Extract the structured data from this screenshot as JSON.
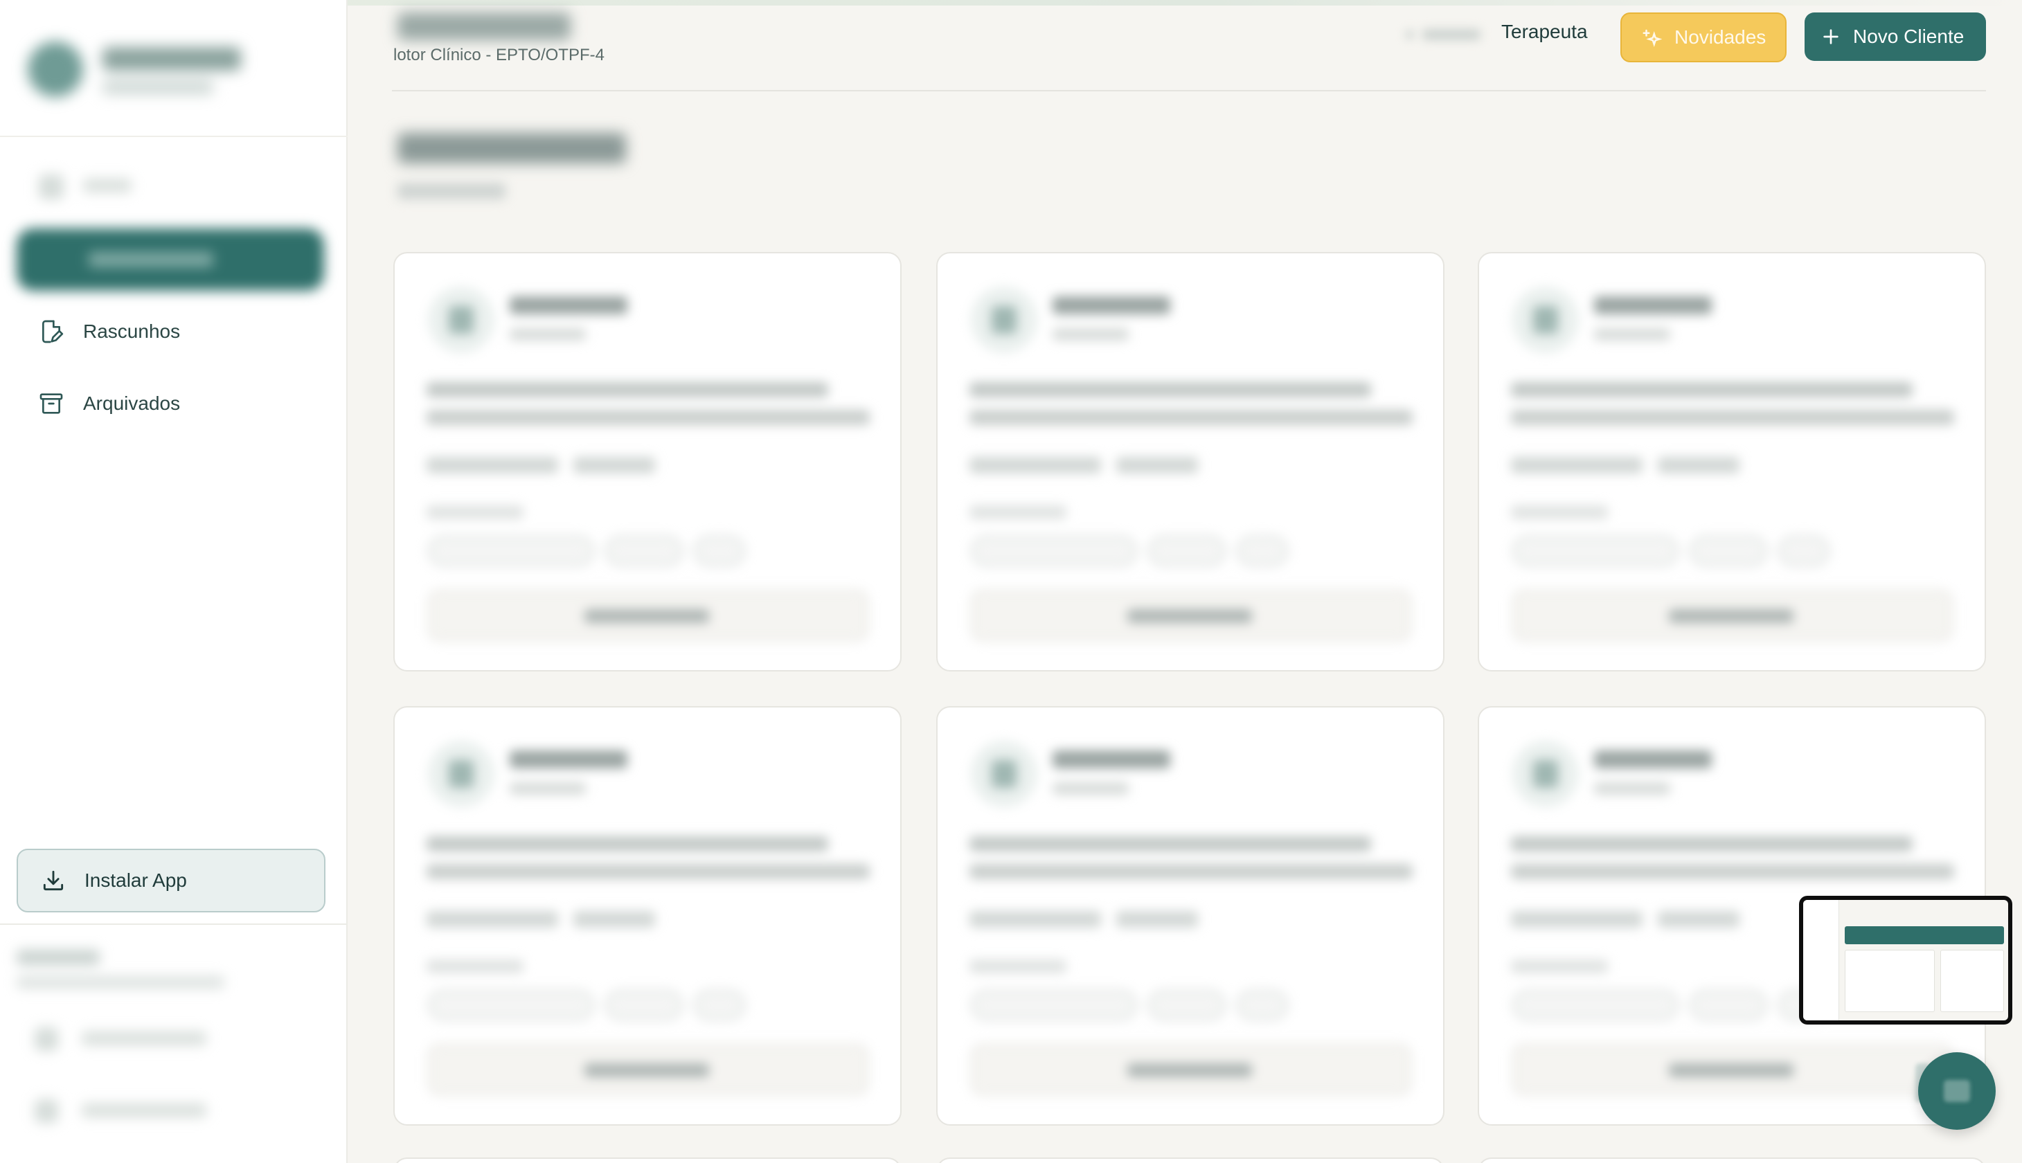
{
  "header": {
    "subtitle": "lotor Clínico - EPTO/OTPF-4",
    "role": "Terapeuta",
    "novidades_label": "Novidades",
    "novo_cliente_label": "Novo Cliente"
  },
  "sidebar": {
    "items": [
      {
        "label": "Rascunhos",
        "icon": "draft-icon"
      },
      {
        "label": "Arquivados",
        "icon": "archive-icon"
      }
    ],
    "install_label": "Instalar App"
  },
  "colors": {
    "primary": "#2f6f6a",
    "accent": "#f5c95b",
    "background": "#f6f5f1",
    "card": "#ffffff"
  },
  "cards": [
    1,
    2,
    3,
    4,
    5,
    6
  ]
}
